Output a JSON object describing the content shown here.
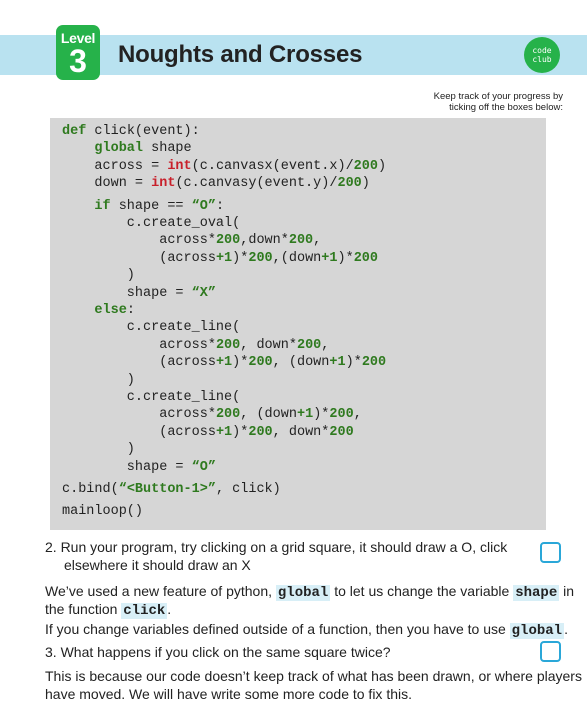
{
  "header": {
    "level_word": "Level",
    "level_number": "3",
    "title": "Noughts and Crosses",
    "logo_line1": "code",
    "logo_line2": "club",
    "accent_color": "#26b24a",
    "band_color": "#b9e2f0"
  },
  "tracker_note": {
    "line1": "Keep track of your progress by",
    "line2": "ticking off the boxes below:"
  },
  "code": {
    "lines": [
      "def click(event):",
      "    global shape",
      "    across = int(c.canvasx(event.x)/200)",
      "    down = int(c.canvasy(event.y)/200)",
      "    if shape == “O”:",
      "        c.create_oval(",
      "            across*200,down*200,",
      "            (across+1)*200,(down+1)*200",
      "        )",
      "        shape = “X”",
      "    else:",
      "        c.create_line(",
      "            across*200, down*200,",
      "            (across+1)*200, (down+1)*200",
      "        )",
      "        c.create_line(",
      "            across*200, (down+1)*200,",
      "            (across+1)*200, down*200",
      "        )",
      "        shape = “O”",
      "c.bind(“<Button-1>”, click)",
      "mainloop()"
    ]
  },
  "body": {
    "step2_line1": "2.  Run your program, try clicking on a grid square, it should draw a O, click",
    "step2_line2": "elsewhere it should draw an X",
    "global_para_a": "We’ve used a new feature of python, ",
    "global_word": "global",
    "global_para_b": " to let us change the variable ",
    "shape_word": "shape",
    "global_para_c": " in",
    "global_para_line2a": "the function ",
    "click_word": "click",
    "global_para_line2b": ".",
    "change_para_a": "If you change variables defined outside of a function, then you have to use ",
    "change_para_b": ".",
    "step3": "3.  What happens if you click on the same square twice?",
    "because_line1": "This is because our code doesn’t keep track of what has been drawn, or where players",
    "because_line2": "have moved. We will have write some more code to fix this."
  }
}
